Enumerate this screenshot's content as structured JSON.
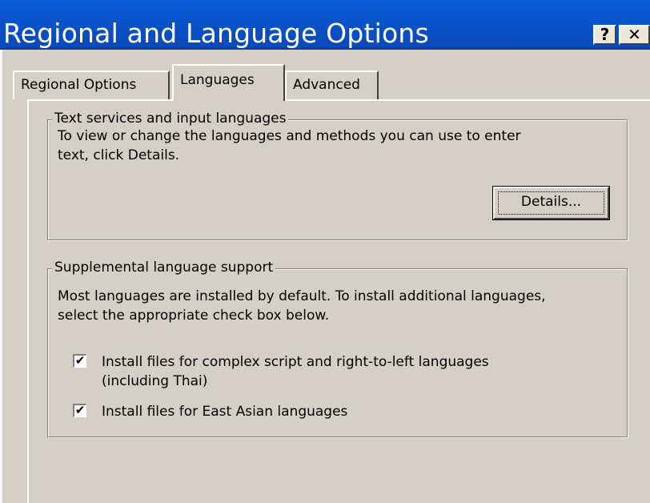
{
  "window": {
    "title": "Regional and Language Options",
    "help_label": "?",
    "close_label": "✕"
  },
  "tabs": [
    {
      "label": "Regional Options",
      "selected": false
    },
    {
      "label": "Languages",
      "selected": true
    },
    {
      "label": "Advanced",
      "selected": false
    }
  ],
  "text_services": {
    "legend": "Text services and input languages",
    "description_line1": "To view or change the languages and methods you can use to enter",
    "description_line2": "text, click Details.",
    "details_button": "Details..."
  },
  "supplemental": {
    "legend": "Supplemental language support",
    "description_line1": "Most languages are installed by default. To install additional languages,",
    "description_line2": "select the appropriate check box below.",
    "checkbox_complex": {
      "label_line1": "Install files for complex script and right-to-left languages",
      "label_line2": "(including Thai)",
      "checked": true
    },
    "checkbox_east_asian": {
      "label": "Install files for East Asian languages",
      "checked": true
    }
  },
  "check_mark": "✔"
}
